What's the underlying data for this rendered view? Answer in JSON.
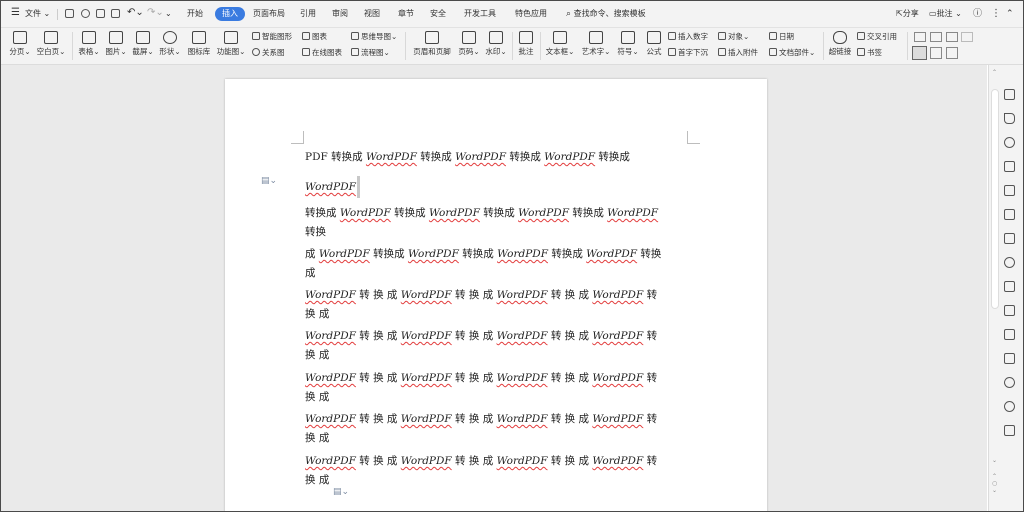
{
  "menu": {
    "file": "文件",
    "tabs": [
      "开始",
      "插入",
      "页面布局",
      "引用",
      "审阅",
      "视图",
      "章节",
      "安全",
      "开发工具",
      "特色应用"
    ],
    "active_tab": "插入",
    "search": "查找命令、搜索模板",
    "share": "分享",
    "comment": "批注"
  },
  "ribbon": {
    "page_break": "分页",
    "blank_page": "空白页",
    "table": "表格",
    "picture": "图片",
    "screenshot": "截屏",
    "shape": "形状",
    "icon_lib": "图标库",
    "func_chart": "功能图",
    "smart_shape": "智能图形",
    "chart": "图表",
    "mind_map": "思维导图",
    "relation": "关系图",
    "online_chart": "在线图表",
    "flowchart": "流程图",
    "header_footer": "页眉和页脚",
    "page_num": "页码",
    "watermark": "水印",
    "annotate": "批注",
    "textbox": "文本框",
    "wordart": "艺术字",
    "symbol": "符号",
    "formula": "公式",
    "insert_number": "插入数字",
    "object": "对象",
    "date": "日期",
    "dropcap": "首字下沉",
    "attachment": "插入附件",
    "doc_parts": "文档部件",
    "hyperlink": "超链接",
    "cross_ref": "交叉引用",
    "bookmark": "书签"
  },
  "document": {
    "lines": [
      [
        {
          "t": "PDF 转换成 "
        },
        {
          "t": "WordPDF",
          "w": 1
        },
        {
          "t": " 转换成 "
        },
        {
          "t": "WordPDF",
          "w": 1
        },
        {
          "t": " 转换成 "
        },
        {
          "t": "WordPDF",
          "w": 1
        },
        {
          "t": " 转换成"
        }
      ],
      [
        {
          "t": "WordPDF",
          "w": 1
        }
      ],
      [
        {
          "t": "转换成 "
        },
        {
          "t": "WordPDF",
          "w": 1
        },
        {
          "t": " 转换成 "
        },
        {
          "t": "WordPDF",
          "w": 1
        },
        {
          "t": " 转换成 "
        },
        {
          "t": "WordPDF",
          "w": 1
        },
        {
          "t": " 转换成 "
        },
        {
          "t": "WordPDF",
          "w": 1
        }
      ],
      [
        {
          "t": "转换"
        }
      ],
      [
        {
          "t": "成 "
        },
        {
          "t": "WordPDF",
          "w": 1
        },
        {
          "t": " 转换成 "
        },
        {
          "t": "WordPDF",
          "w": 1
        },
        {
          "t": " 转换成 "
        },
        {
          "t": "WordPDF",
          "w": 1
        },
        {
          "t": " 转换成 "
        },
        {
          "t": "WordPDF",
          "w": 1
        },
        {
          "t": " 转换"
        }
      ],
      [
        {
          "t": "成"
        }
      ],
      [
        {
          "t": "WordPDF",
          "w": 1
        },
        {
          "t": " 转 换 成 "
        },
        {
          "t": "WordPDF",
          "w": 1
        },
        {
          "t": " 转 换 成 "
        },
        {
          "t": "WordPDF",
          "w": 1
        },
        {
          "t": " 转 换 成 "
        },
        {
          "t": "WordPDF",
          "w": 1
        },
        {
          "t": " 转"
        }
      ],
      [
        {
          "t": "换 成"
        }
      ],
      [
        {
          "t": "WordPDF",
          "w": 1
        },
        {
          "t": " 转 换 成 "
        },
        {
          "t": "WordPDF",
          "w": 1
        },
        {
          "t": " 转 换 成 "
        },
        {
          "t": "WordPDF",
          "w": 1
        },
        {
          "t": " 转 换 成 "
        },
        {
          "t": "WordPDF",
          "w": 1
        },
        {
          "t": " 转"
        }
      ],
      [
        {
          "t": "换 成"
        }
      ],
      [
        {
          "t": "WordPDF",
          "w": 1
        },
        {
          "t": " 转 换 成 "
        },
        {
          "t": "WordPDF",
          "w": 1
        },
        {
          "t": " 转 换 成 "
        },
        {
          "t": "WordPDF",
          "w": 1
        },
        {
          "t": " 转 换 成 "
        },
        {
          "t": "WordPDF",
          "w": 1
        },
        {
          "t": " 转"
        }
      ],
      [
        {
          "t": "换 成"
        }
      ],
      [
        {
          "t": "WordPDF",
          "w": 1
        },
        {
          "t": " 转 换 成 "
        },
        {
          "t": "WordPDF",
          "w": 1
        },
        {
          "t": " 转 换 成 "
        },
        {
          "t": "WordPDF",
          "w": 1
        },
        {
          "t": " 转 换 成 "
        },
        {
          "t": "WordPDF",
          "w": 1
        },
        {
          "t": " 转"
        }
      ],
      [
        {
          "t": "换 成"
        }
      ],
      [
        {
          "t": "WordPDF",
          "w": 1
        },
        {
          "t": " 转 换 成 "
        },
        {
          "t": "WordPDF",
          "w": 1
        },
        {
          "t": " 转 换 成 "
        },
        {
          "t": "WordPDF",
          "w": 1
        },
        {
          "t": " 转 换 成 "
        },
        {
          "t": "WordPDF",
          "w": 1
        },
        {
          "t": " 转"
        }
      ],
      [
        {
          "t": "换 成"
        }
      ]
    ]
  },
  "colors": {
    "accent": "#3a7be0",
    "spellcheck": "#e23c3c"
  }
}
